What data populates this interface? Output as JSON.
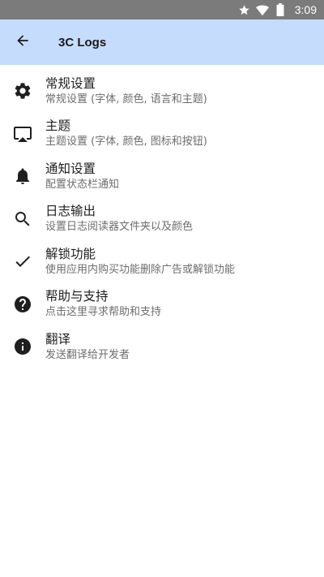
{
  "status_bar": {
    "time": "3:09",
    "icons": [
      "star-icon",
      "wifi-icon",
      "battery-icon"
    ],
    "background": "#7b7b7b"
  },
  "app_bar": {
    "title": "3C Logs",
    "back_icon": "arrow-back-icon",
    "background": "#c6dcfc"
  },
  "settings": [
    {
      "icon": "gear-icon",
      "title": "常规设置",
      "subtitle": "常规设置 (字体, 颜色, 语言和主题)"
    },
    {
      "icon": "cast-icon",
      "title": "主题",
      "subtitle": "主题设置 (字体, 颜色, 图标和按钮)"
    },
    {
      "icon": "bell-icon",
      "title": "通知设置",
      "subtitle": "配置状态栏通知"
    },
    {
      "icon": "search-icon",
      "title": "日志输出",
      "subtitle": "设置日志阅读器文件夹以及颜色"
    },
    {
      "icon": "check-icon",
      "title": "解锁功能",
      "subtitle": "使用应用内购买功能删除广告或解锁功能"
    },
    {
      "icon": "help-icon",
      "title": "帮助与支持",
      "subtitle": "点击这里寻求帮助和支持"
    },
    {
      "icon": "info-icon",
      "title": "翻译",
      "subtitle": "发送翻译给开发者"
    }
  ]
}
